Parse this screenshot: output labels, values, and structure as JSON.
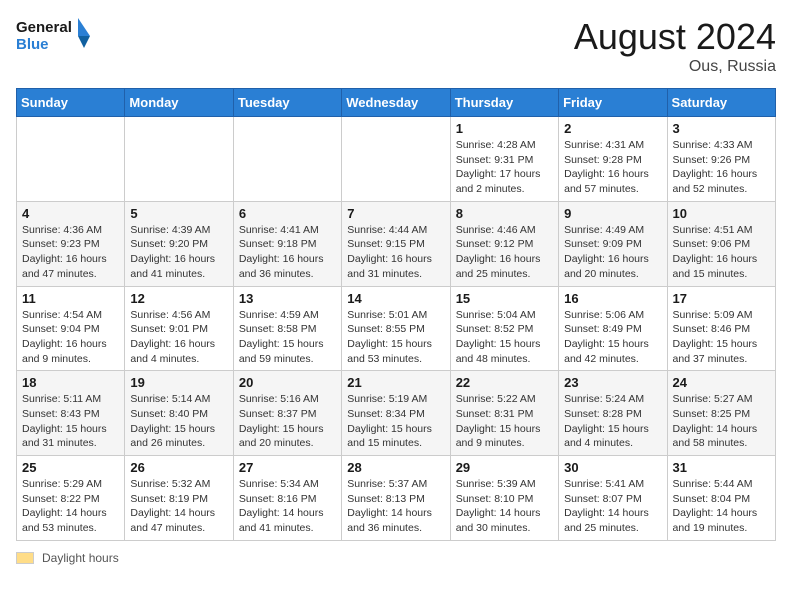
{
  "header": {
    "logo_line1": "General",
    "logo_line2": "Blue",
    "month_year": "August 2024",
    "location": "Ous, Russia"
  },
  "weekdays": [
    "Sunday",
    "Monday",
    "Tuesday",
    "Wednesday",
    "Thursday",
    "Friday",
    "Saturday"
  ],
  "footer_label": "Daylight hours",
  "weeks": [
    [
      {
        "day": "",
        "info": ""
      },
      {
        "day": "",
        "info": ""
      },
      {
        "day": "",
        "info": ""
      },
      {
        "day": "",
        "info": ""
      },
      {
        "day": "1",
        "info": "Sunrise: 4:28 AM\nSunset: 9:31 PM\nDaylight: 17 hours\nand 2 minutes."
      },
      {
        "day": "2",
        "info": "Sunrise: 4:31 AM\nSunset: 9:28 PM\nDaylight: 16 hours\nand 57 minutes."
      },
      {
        "day": "3",
        "info": "Sunrise: 4:33 AM\nSunset: 9:26 PM\nDaylight: 16 hours\nand 52 minutes."
      }
    ],
    [
      {
        "day": "4",
        "info": "Sunrise: 4:36 AM\nSunset: 9:23 PM\nDaylight: 16 hours\nand 47 minutes."
      },
      {
        "day": "5",
        "info": "Sunrise: 4:39 AM\nSunset: 9:20 PM\nDaylight: 16 hours\nand 41 minutes."
      },
      {
        "day": "6",
        "info": "Sunrise: 4:41 AM\nSunset: 9:18 PM\nDaylight: 16 hours\nand 36 minutes."
      },
      {
        "day": "7",
        "info": "Sunrise: 4:44 AM\nSunset: 9:15 PM\nDaylight: 16 hours\nand 31 minutes."
      },
      {
        "day": "8",
        "info": "Sunrise: 4:46 AM\nSunset: 9:12 PM\nDaylight: 16 hours\nand 25 minutes."
      },
      {
        "day": "9",
        "info": "Sunrise: 4:49 AM\nSunset: 9:09 PM\nDaylight: 16 hours\nand 20 minutes."
      },
      {
        "day": "10",
        "info": "Sunrise: 4:51 AM\nSunset: 9:06 PM\nDaylight: 16 hours\nand 15 minutes."
      }
    ],
    [
      {
        "day": "11",
        "info": "Sunrise: 4:54 AM\nSunset: 9:04 PM\nDaylight: 16 hours\nand 9 minutes."
      },
      {
        "day": "12",
        "info": "Sunrise: 4:56 AM\nSunset: 9:01 PM\nDaylight: 16 hours\nand 4 minutes."
      },
      {
        "day": "13",
        "info": "Sunrise: 4:59 AM\nSunset: 8:58 PM\nDaylight: 15 hours\nand 59 minutes."
      },
      {
        "day": "14",
        "info": "Sunrise: 5:01 AM\nSunset: 8:55 PM\nDaylight: 15 hours\nand 53 minutes."
      },
      {
        "day": "15",
        "info": "Sunrise: 5:04 AM\nSunset: 8:52 PM\nDaylight: 15 hours\nand 48 minutes."
      },
      {
        "day": "16",
        "info": "Sunrise: 5:06 AM\nSunset: 8:49 PM\nDaylight: 15 hours\nand 42 minutes."
      },
      {
        "day": "17",
        "info": "Sunrise: 5:09 AM\nSunset: 8:46 PM\nDaylight: 15 hours\nand 37 minutes."
      }
    ],
    [
      {
        "day": "18",
        "info": "Sunrise: 5:11 AM\nSunset: 8:43 PM\nDaylight: 15 hours\nand 31 minutes."
      },
      {
        "day": "19",
        "info": "Sunrise: 5:14 AM\nSunset: 8:40 PM\nDaylight: 15 hours\nand 26 minutes."
      },
      {
        "day": "20",
        "info": "Sunrise: 5:16 AM\nSunset: 8:37 PM\nDaylight: 15 hours\nand 20 minutes."
      },
      {
        "day": "21",
        "info": "Sunrise: 5:19 AM\nSunset: 8:34 PM\nDaylight: 15 hours\nand 15 minutes."
      },
      {
        "day": "22",
        "info": "Sunrise: 5:22 AM\nSunset: 8:31 PM\nDaylight: 15 hours\nand 9 minutes."
      },
      {
        "day": "23",
        "info": "Sunrise: 5:24 AM\nSunset: 8:28 PM\nDaylight: 15 hours\nand 4 minutes."
      },
      {
        "day": "24",
        "info": "Sunrise: 5:27 AM\nSunset: 8:25 PM\nDaylight: 14 hours\nand 58 minutes."
      }
    ],
    [
      {
        "day": "25",
        "info": "Sunrise: 5:29 AM\nSunset: 8:22 PM\nDaylight: 14 hours\nand 53 minutes."
      },
      {
        "day": "26",
        "info": "Sunrise: 5:32 AM\nSunset: 8:19 PM\nDaylight: 14 hours\nand 47 minutes."
      },
      {
        "day": "27",
        "info": "Sunrise: 5:34 AM\nSunset: 8:16 PM\nDaylight: 14 hours\nand 41 minutes."
      },
      {
        "day": "28",
        "info": "Sunrise: 5:37 AM\nSunset: 8:13 PM\nDaylight: 14 hours\nand 36 minutes."
      },
      {
        "day": "29",
        "info": "Sunrise: 5:39 AM\nSunset: 8:10 PM\nDaylight: 14 hours\nand 30 minutes."
      },
      {
        "day": "30",
        "info": "Sunrise: 5:41 AM\nSunset: 8:07 PM\nDaylight: 14 hours\nand 25 minutes."
      },
      {
        "day": "31",
        "info": "Sunrise: 5:44 AM\nSunset: 8:04 PM\nDaylight: 14 hours\nand 19 minutes."
      }
    ]
  ]
}
